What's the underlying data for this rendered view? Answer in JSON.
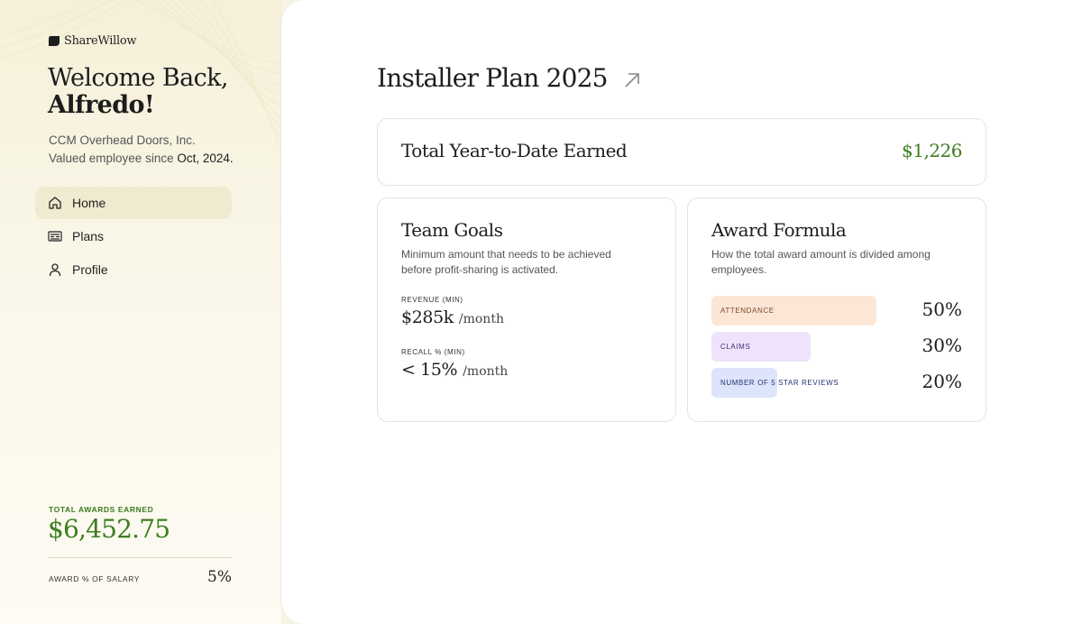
{
  "brand": {
    "name": "ShareWillow"
  },
  "welcome": {
    "line1": "Welcome Back,",
    "name": "Alfredo!"
  },
  "profile": {
    "company": "CCM Overhead Doors, Inc.",
    "since_prefix": "Valued employee since ",
    "since_date": "Oct, 2024."
  },
  "nav": {
    "items": [
      {
        "label": "Home",
        "icon": "home-icon",
        "active": true
      },
      {
        "label": "Plans",
        "icon": "plans-icon",
        "active": false
      },
      {
        "label": "Profile",
        "icon": "profile-icon",
        "active": false
      }
    ]
  },
  "summary": {
    "total_awards_label": "TOTAL AWARDS EARNED",
    "total_awards_value": "$6,452.75",
    "salary_label": "AWARD % OF SALARY",
    "salary_value": "5%"
  },
  "plan": {
    "title": "Installer Plan 2025",
    "link_icon": "arrow-up-right-icon"
  },
  "ytd": {
    "label": "Total Year-to-Date Earned",
    "value": "$1,226"
  },
  "team_goals": {
    "title": "Team Goals",
    "description": "Minimum amount that needs to be achieved before profit-sharing is activated.",
    "metrics": [
      {
        "label": "REVENUE (MIN)",
        "value": "$285k",
        "unit": "/month"
      },
      {
        "label": "RECALL % (MIN)",
        "value": "< 15%",
        "unit": "/month"
      }
    ]
  },
  "award_formula": {
    "title": "Award Formula",
    "description": "How the total award amount is divided among employees.",
    "items": [
      {
        "label": "ATTENDANCE",
        "percent": "50%",
        "share": 0.5,
        "color": "#fce6d6",
        "text_color": "#7a4a2a"
      },
      {
        "label": "CLAIMS",
        "percent": "30%",
        "share": 0.3,
        "color": "#efe3fb",
        "text_color": "#4a2a7a"
      },
      {
        "label": "NUMBER OF 5 STAR REVIEWS",
        "percent": "20%",
        "share": 0.2,
        "color": "#dde4fb",
        "text_color": "#1f3470"
      }
    ]
  },
  "colors": {
    "accent_green": "#3e7d1f",
    "nav_active": "#f0ead0"
  }
}
